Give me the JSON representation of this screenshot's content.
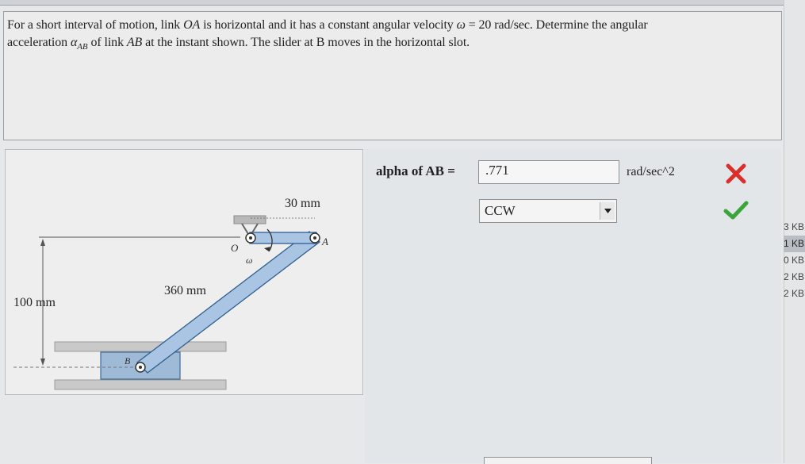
{
  "question": {
    "line1_a": "For a short interval of motion, link ",
    "line1_oa": "OA",
    "line1_b": " is horizontal and it has a constant angular velocity ",
    "line1_omega": "ω",
    "line1_c": " = 20 rad/sec. Determine the angular",
    "line2_a": "acceleration ",
    "line2_alpha": "α",
    "line2_sub": "AB",
    "line2_b": " of link ",
    "line2_ab": "AB",
    "line2_c": " at the instant shown. The slider at B moves in the horizontal slot."
  },
  "figure": {
    "dim_top": "30 mm",
    "dim_link": "360 mm",
    "dim_vertical": "100 mm",
    "label_o": "O",
    "label_a": "A",
    "label_b": "B",
    "label_omega": "ω"
  },
  "answer": {
    "label": "alpha of AB =",
    "value": ".771",
    "unit": "rad/sec^2",
    "direction": "CCW",
    "value_status": "incorrect",
    "direction_status": "correct"
  },
  "sidebar_sizes": [
    "3 KB",
    "1 KB",
    "0 KB",
    "2 KB",
    "2 KB"
  ],
  "colors": {
    "link_fill": "#a9c5e3",
    "link_stroke": "#2f5f8f",
    "incorrect": "#d9302c",
    "correct": "#3aa53a"
  }
}
